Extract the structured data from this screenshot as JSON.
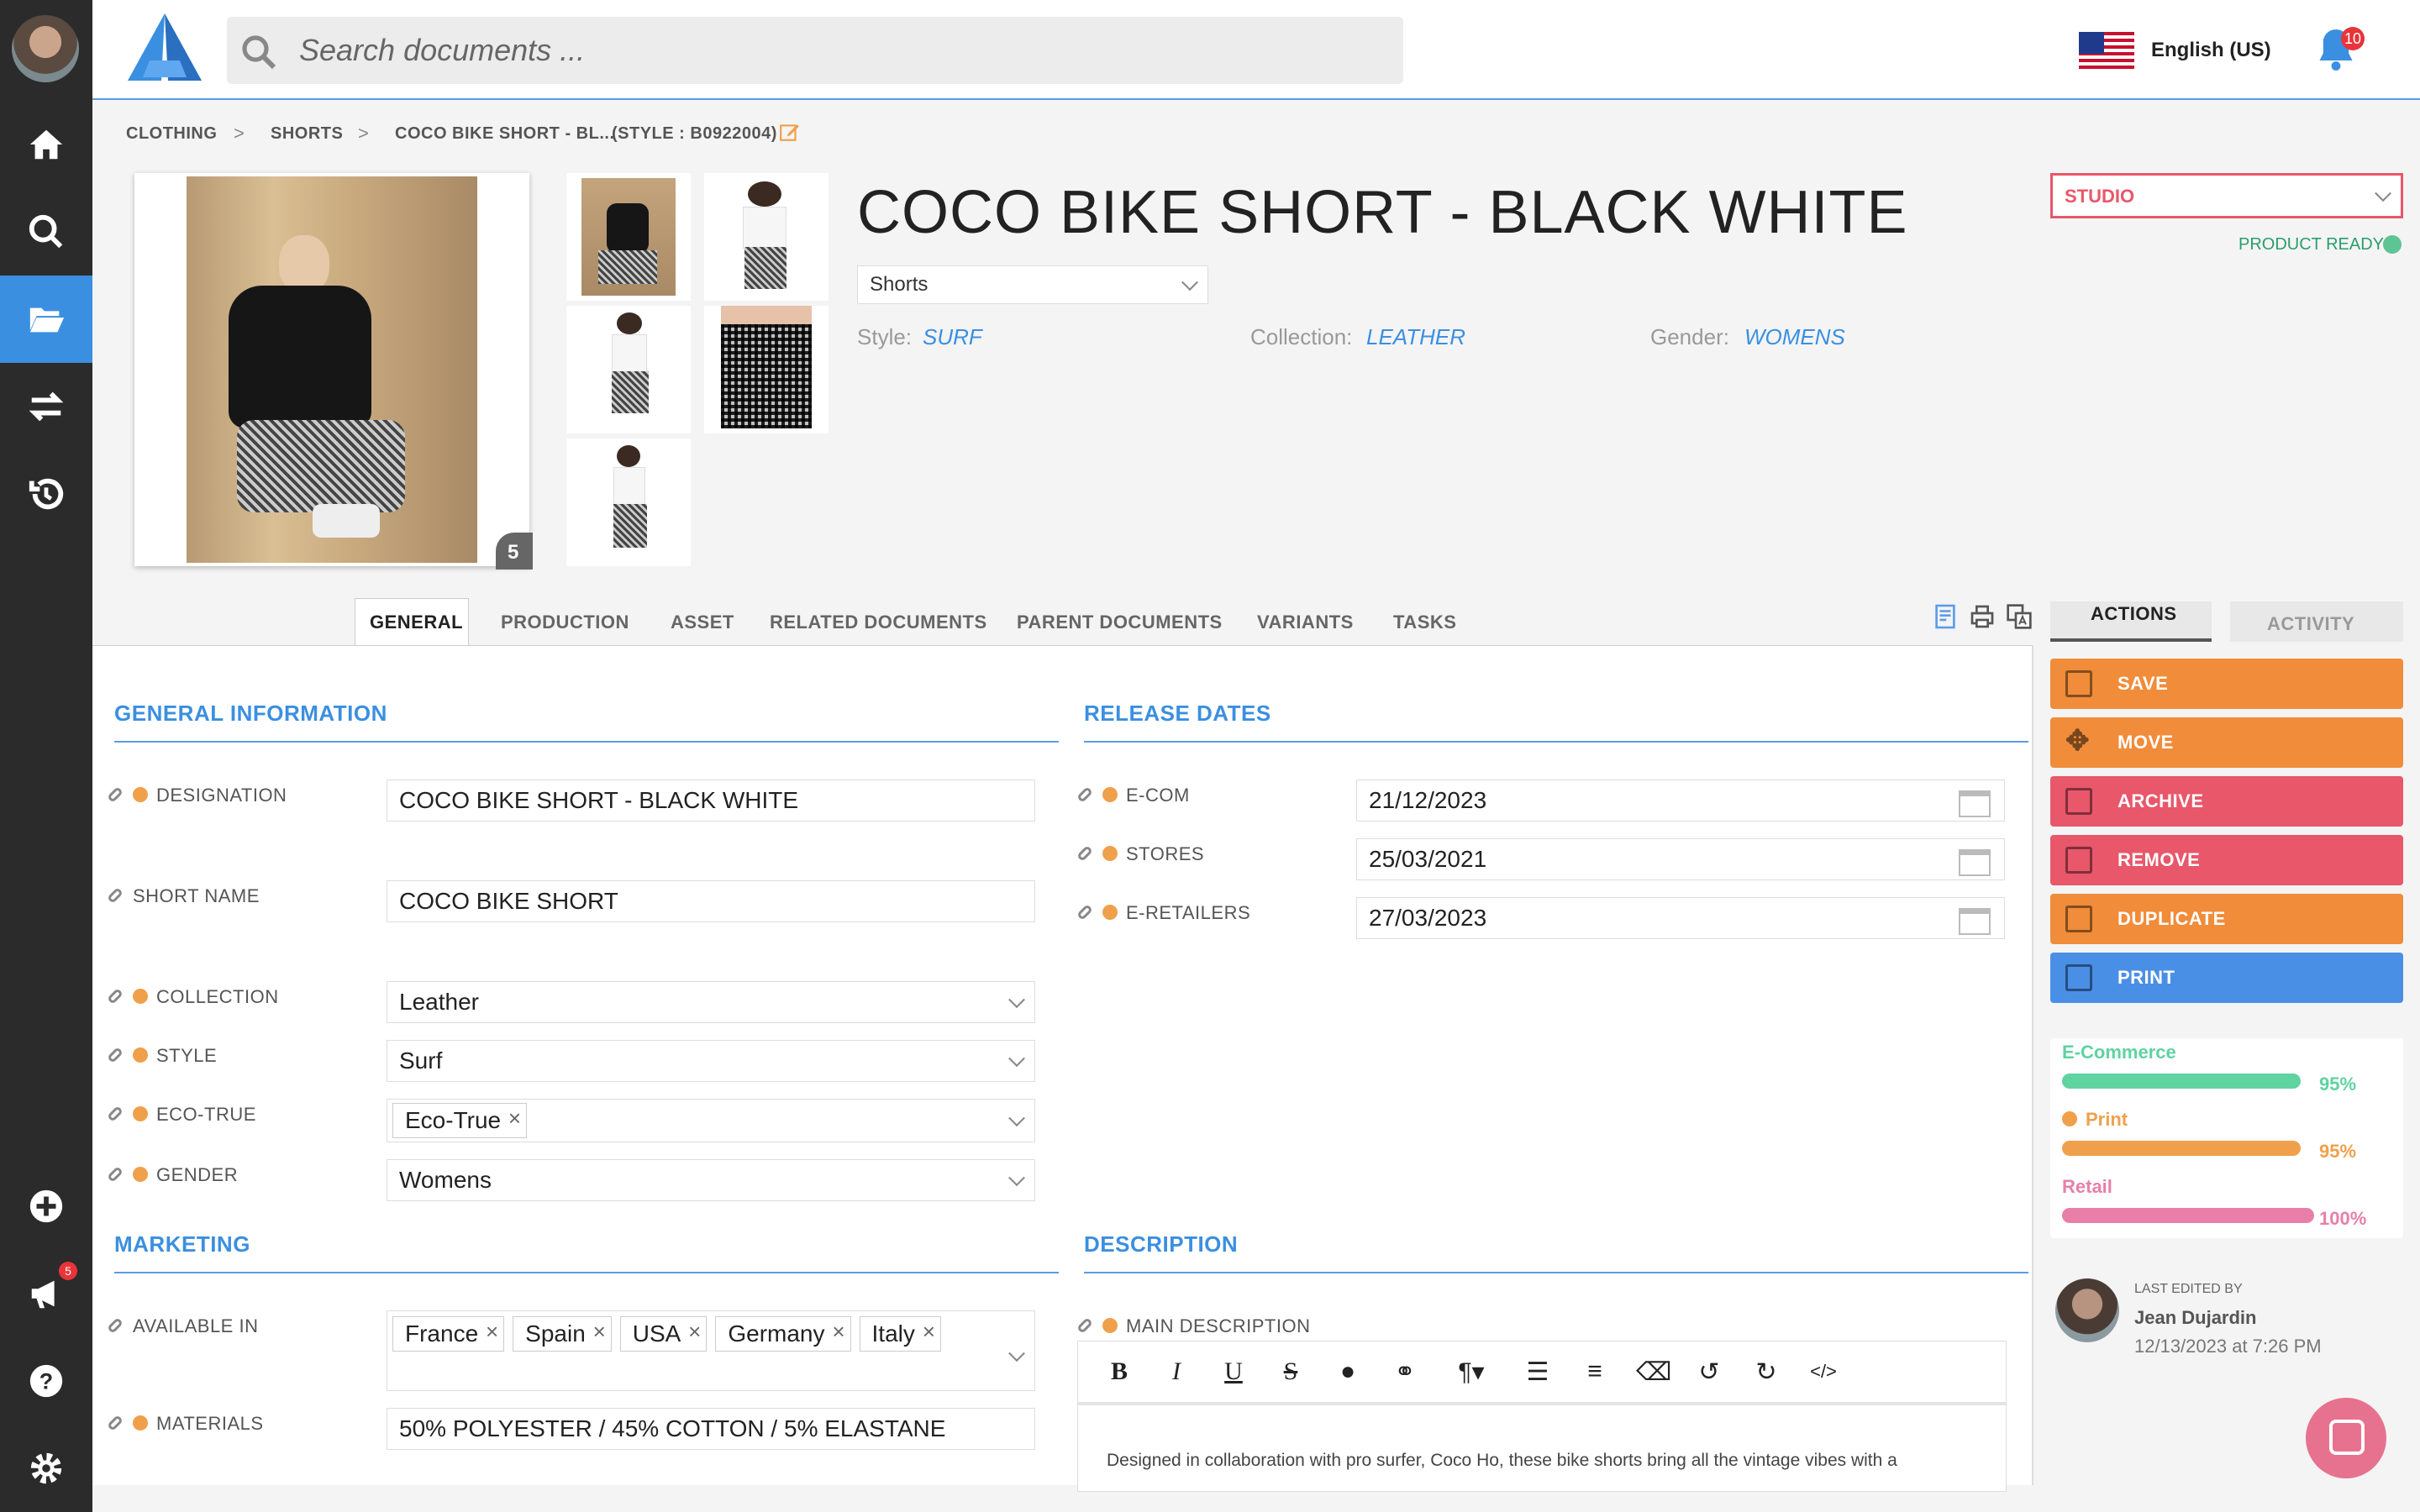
{
  "search": {
    "placeholder": "Search documents ..."
  },
  "language": {
    "label": "English (US)"
  },
  "notifications": {
    "count": "10"
  },
  "sidebar": {
    "items": [
      "home",
      "search",
      "documents",
      "transfer",
      "history"
    ],
    "bottom": [
      "add",
      "announcements",
      "help",
      "settings"
    ],
    "announcements_count": "5"
  },
  "breadcrumb": {
    "items": [
      "CLOTHING",
      "SHORTS",
      "COCO BIKE SHORT - BL...",
      "(STYLE : B0922004)"
    ],
    "separator": ">"
  },
  "product": {
    "title": "COCO BIKE SHORT - BLACK WHITE",
    "category": "Shorts",
    "image_count": "5",
    "meta": [
      {
        "label": "Style:",
        "value": "SURF"
      },
      {
        "label": "Collection:",
        "value": "LEATHER"
      },
      {
        "label": "Gender:",
        "value": "WOMENS"
      }
    ]
  },
  "studio": {
    "value": "STUDIO",
    "status": "PRODUCT READY"
  },
  "tabs": [
    "GENERAL",
    "PRODUCTION",
    "ASSET",
    "RELATED DOCUMENTS",
    "PARENT DOCUMENTS",
    "VARIANTS",
    "TASKS"
  ],
  "right_tabs": [
    "ACTIONS",
    "ACTIVITY"
  ],
  "general": {
    "title": "GENERAL INFORMATION",
    "designation": {
      "label": "DESIGNATION",
      "value": "COCO BIKE SHORT - BLACK WHITE"
    },
    "short_name": {
      "label": "SHORT NAME",
      "value": "COCO BIKE SHORT"
    },
    "collection": {
      "label": "COLLECTION",
      "value": "Leather"
    },
    "style": {
      "label": "STYLE",
      "value": "Surf"
    },
    "eco_true": {
      "label": "ECO-TRUE",
      "value": "Eco-True"
    },
    "gender": {
      "label": "GENDER",
      "value": "Womens"
    }
  },
  "release": {
    "title": "RELEASE DATES",
    "ecom": {
      "label": "E-COM",
      "value": "21/12/2023"
    },
    "stores": {
      "label": "STORES",
      "value": "25/03/2021"
    },
    "eretailers": {
      "label": "E-RETAILERS",
      "value": "27/03/2023"
    }
  },
  "marketing": {
    "title": "MARKETING",
    "available_in": {
      "label": "AVAILABLE IN",
      "values": [
        "France",
        "Spain",
        "USA",
        "Germany",
        "Italy"
      ]
    },
    "materials": {
      "label": "MATERIALS",
      "value": "50% POLYESTER / 45% COTTON / 5% ELASTANE"
    }
  },
  "description": {
    "title": "DESCRIPTION",
    "main_label": "MAIN DESCRIPTION",
    "text": "Designed in collaboration with pro surfer, Coco Ho, these bike shorts bring all the vintage vibes with a"
  },
  "actions": [
    "SAVE",
    "MOVE",
    "ARCHIVE",
    "REMOVE",
    "DUPLICATE",
    "PRINT"
  ],
  "colors": {
    "orange": "#f08c3a",
    "red": "#e8576a",
    "blue": "#4a8fe6",
    "green": "#5fd3a0",
    "pink": "#e87fa8",
    "accent": "#3b8fe0"
  },
  "progress": [
    {
      "label": "E-Commerce",
      "percent": 95,
      "text": "95%"
    },
    {
      "label": "Print",
      "percent": 95,
      "text": "95%"
    },
    {
      "label": "Retail",
      "percent": 100,
      "text": "100%"
    }
  ],
  "last_edited": {
    "label": "LAST EDITED BY",
    "name": "Jean Dujardin",
    "date": "12/13/2023 at 7:26 PM"
  }
}
